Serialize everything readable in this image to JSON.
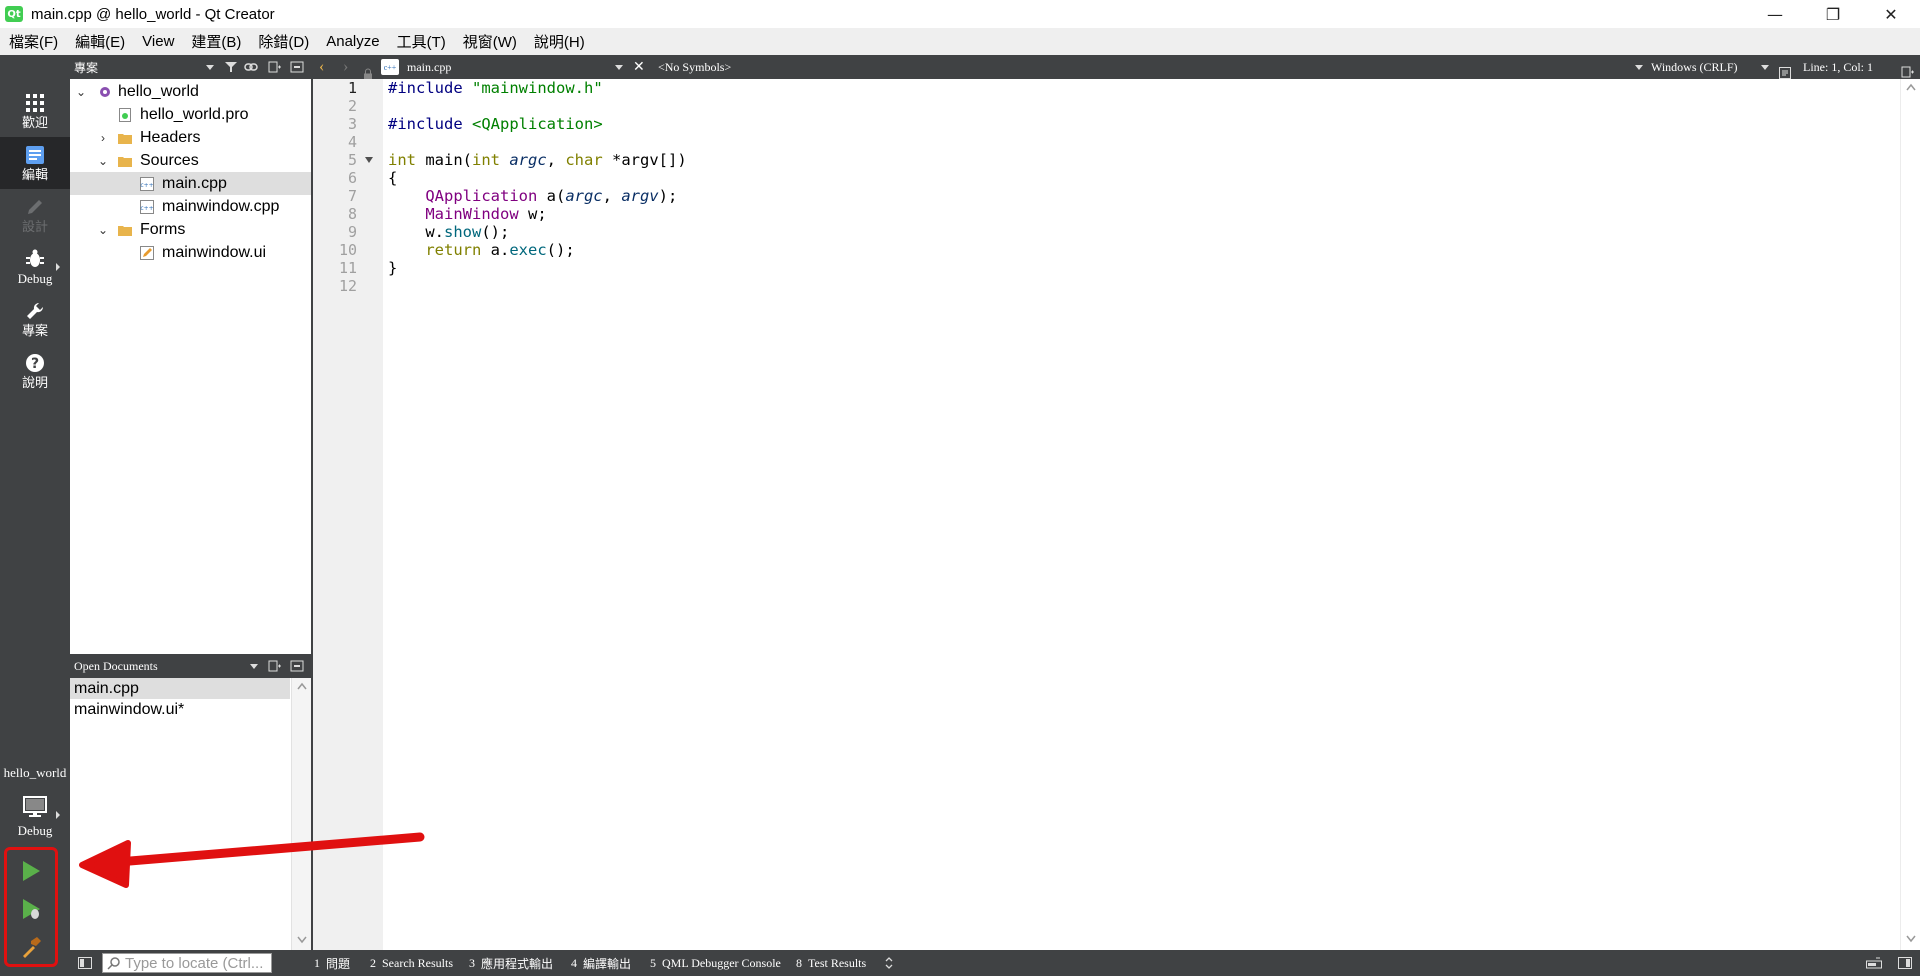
{
  "window": {
    "app_icon_text": "Qt",
    "title": "main.cpp @ hello_world - Qt Creator",
    "minimize": "—",
    "restore": "❐",
    "close": "✕"
  },
  "menu": [
    "檔案(F)",
    "編輯(E)",
    "View",
    "建置(B)",
    "除錯(D)",
    "Analyze",
    "工具(T)",
    "視窗(W)",
    "說明(H)"
  ],
  "modes": [
    {
      "label": "歡迎",
      "icon": "grid-icon",
      "active": false
    },
    {
      "label": "編輯",
      "icon": "edit-document-icon",
      "active": true
    },
    {
      "label": "設計",
      "icon": "pencil-icon",
      "active": false,
      "disabled": true
    },
    {
      "label": "Debug",
      "icon": "bug-icon",
      "active": false
    },
    {
      "label": "專案",
      "icon": "wrench-icon",
      "active": false
    },
    {
      "label": "說明",
      "icon": "help-icon",
      "active": false
    }
  ],
  "kit": {
    "project": "hello_world",
    "build": "Debug"
  },
  "project_pane": {
    "title": "專案",
    "tree": [
      {
        "label": "hello_world",
        "level": 0,
        "expanded": true,
        "icon": "project-icon"
      },
      {
        "label": "hello_world.pro",
        "level": 1,
        "icon": "pro-file-icon"
      },
      {
        "label": "Headers",
        "level": 1,
        "expanded": false,
        "icon": "folder-icon"
      },
      {
        "label": "Sources",
        "level": 1,
        "expanded": true,
        "icon": "folder-icon"
      },
      {
        "label": "main.cpp",
        "level": 2,
        "icon": "cpp-file-icon",
        "selected": true
      },
      {
        "label": "mainwindow.cpp",
        "level": 2,
        "icon": "cpp-file-icon"
      },
      {
        "label": "Forms",
        "level": 1,
        "expanded": true,
        "icon": "folder-icon"
      },
      {
        "label": "mainwindow.ui",
        "level": 2,
        "icon": "ui-file-icon"
      }
    ]
  },
  "open_documents": {
    "title": "Open Documents",
    "items": [
      {
        "label": "main.cpp",
        "selected": true
      },
      {
        "label": "mainwindow.ui*",
        "selected": false
      }
    ]
  },
  "editor_toolbar": {
    "file": "main.cpp",
    "file_icon": "c++",
    "symbols": "<No Symbols>",
    "line_ending": "Windows (CRLF)",
    "position": "Line: 1, Col: 1"
  },
  "editor": {
    "lines": [
      "#include \"mainwindow.h\"",
      "",
      "#include <QApplication>",
      "",
      "int main(int argc, char *argv[])",
      "{",
      "    QApplication a(argc, argv);",
      "    MainWindow w;",
      "    w.show();",
      "    return a.exec();",
      "}",
      ""
    ],
    "current_line": 1,
    "fold_line": 5
  },
  "statusbar": {
    "locator_placeholder": "Type to locate (Ctrl...",
    "tabs": [
      {
        "num": "1",
        "label": "問題"
      },
      {
        "num": "2",
        "label": "Search Results"
      },
      {
        "num": "3",
        "label": "應用程式輸出"
      },
      {
        "num": "4",
        "label": "編譯輸出"
      },
      {
        "num": "5",
        "label": "QML Debugger Console"
      },
      {
        "num": "8",
        "label": "Test Results"
      }
    ]
  },
  "colors": {
    "sidebar": "#404244",
    "active_mode": "#262729",
    "annotation": "#e01010",
    "run_green": "#5ab04a"
  }
}
